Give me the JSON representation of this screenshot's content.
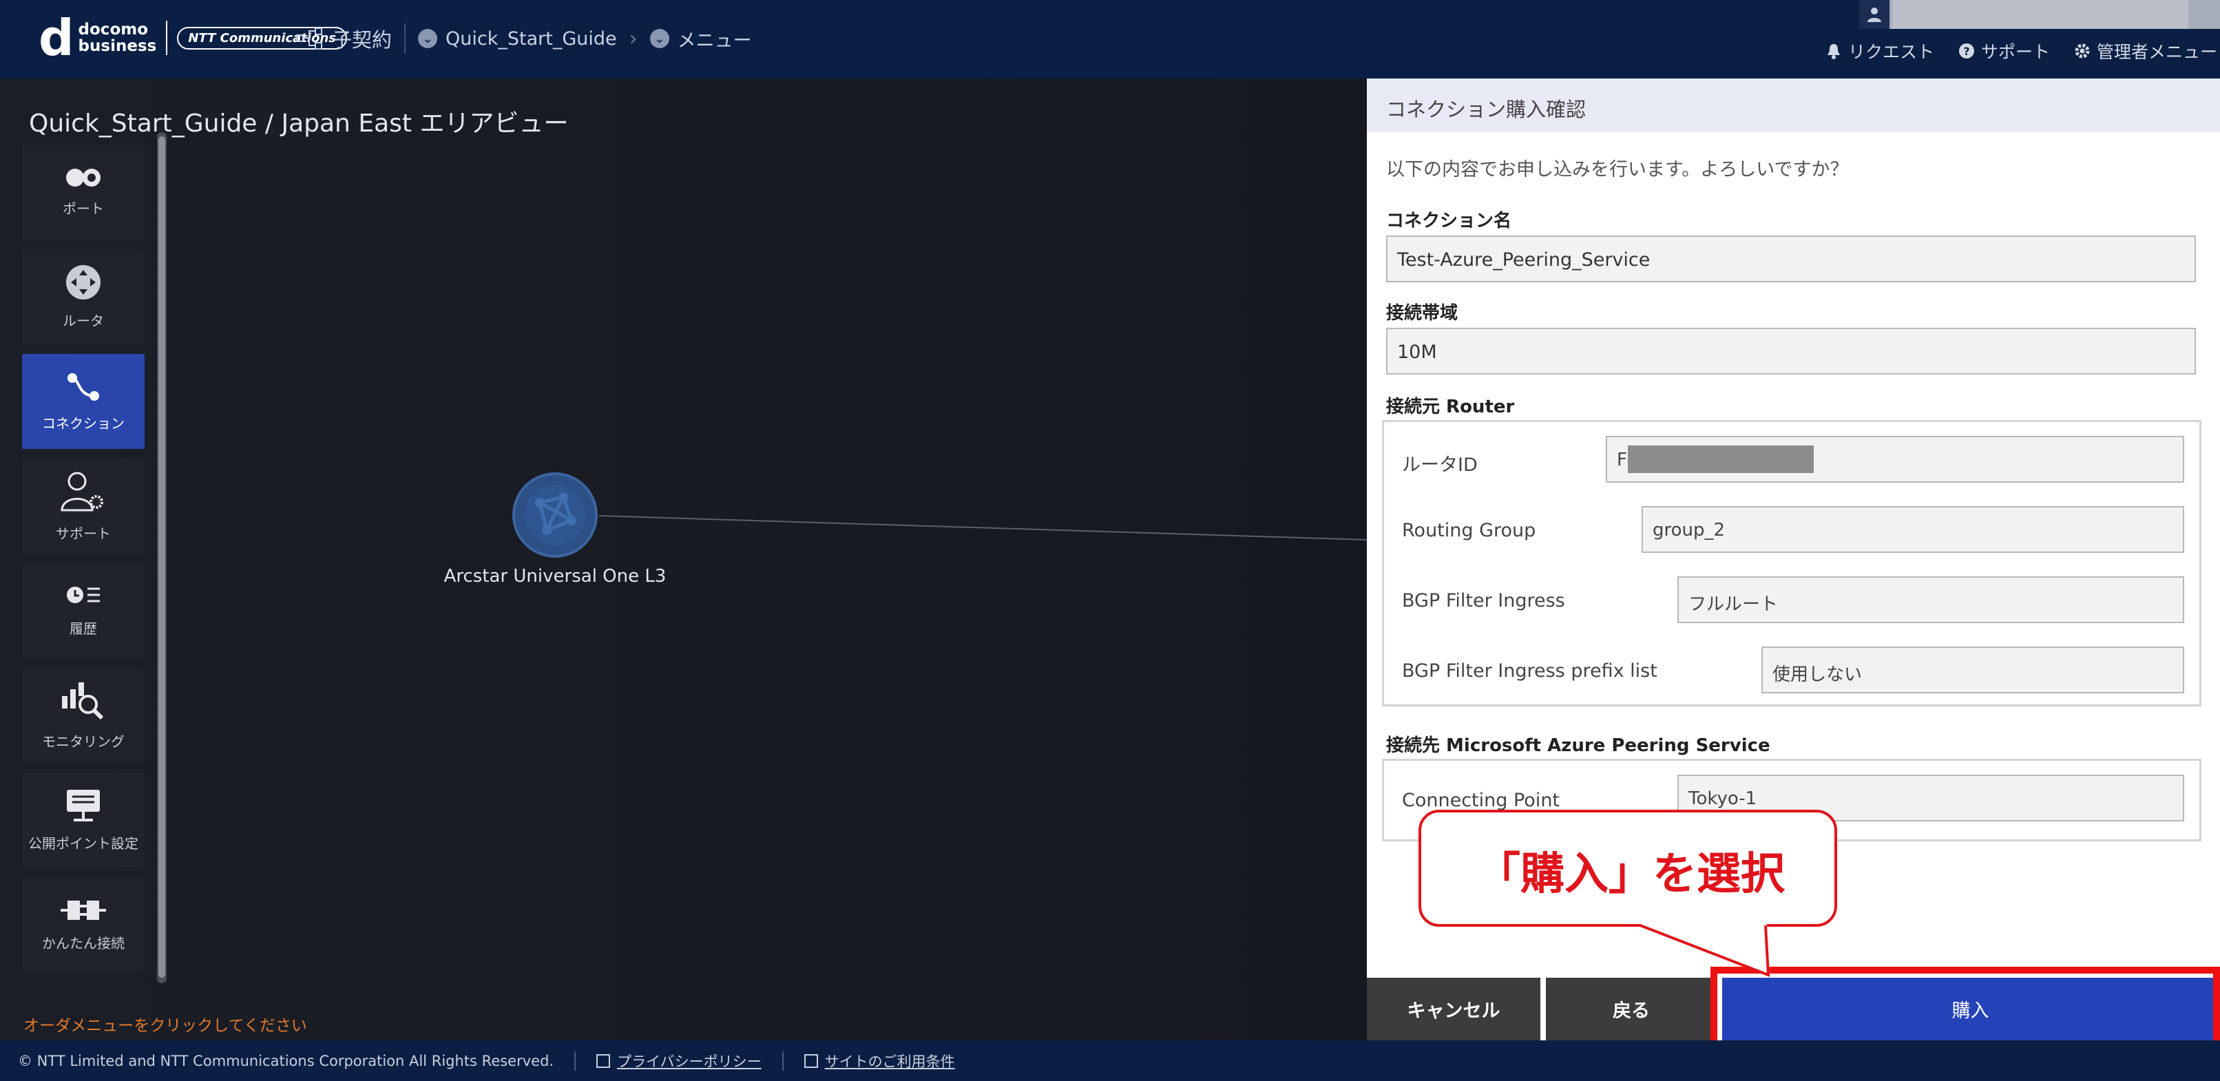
{
  "header": {
    "logo_line1": "docomo",
    "logo_line2": "business",
    "ntt_badge": "NTT Communications",
    "subcontract_label": "子契約",
    "breadcrumb_project": "Quick_Start_Guide",
    "breadcrumb_menu": "メニュー",
    "links": {
      "request": "リクエスト",
      "support": "サポート",
      "admin_menu": "管理者メニュー"
    }
  },
  "canvas": {
    "area_title": "Quick_Start_Guide / Japan East エリアビュー",
    "tools": [
      {
        "label": "ポート",
        "icon": "port-icon"
      },
      {
        "label": "ルータ",
        "icon": "router-icon"
      },
      {
        "label": "コネクション",
        "icon": "connection-icon",
        "active": true
      },
      {
        "label": "サポート",
        "icon": "support-person-icon"
      },
      {
        "label": "履歴",
        "icon": "history-icon"
      },
      {
        "label": "モニタリング",
        "icon": "monitoring-icon"
      },
      {
        "label": "公開ポイント設定",
        "icon": "public-point-icon"
      },
      {
        "label": "かんたん接続",
        "icon": "easy-connect-icon"
      }
    ],
    "order_hint": "オーダメニューをクリックしてください",
    "node_label": "Arcstar Universal One L3"
  },
  "panel": {
    "title": "コネクション購入確認",
    "intro": "以下の内容でお申し込みを行います。よろしいですか？",
    "connection_name_label": "コネクション名",
    "connection_name": "Test-Azure_Peering_Service",
    "bandwidth_label": "接続帯域",
    "bandwidth": "10M",
    "source_label": "接続元 Router",
    "router_id_label": "ルータID",
    "router_id_prefix": "F",
    "routing_group_label": "Routing Group",
    "routing_group": "group_2",
    "bgp_ingress_label": "BGP Filter Ingress",
    "bgp_ingress": "フルルート",
    "bgp_prefix_label": "BGP Filter Ingress prefix list",
    "bgp_prefix": "使用しない",
    "dest_label": "接続先 Microsoft Azure Peering Service",
    "connecting_point_label": "Connecting Point",
    "connecting_point": "Tokyo-1",
    "buttons": {
      "cancel": "キャンセル",
      "back": "戻る",
      "buy": "購入"
    }
  },
  "callout": {
    "text": "「購入」を選択"
  },
  "footer": {
    "copyright": "© NTT Limited and NTT Communications Corporation All Rights Reserved.",
    "privacy": "プライバシーポリシー",
    "terms": "サイトのご利用条件"
  },
  "colors": {
    "header_bg": "#0b1f44",
    "accent_blue": "#2543b8",
    "highlight_red": "#e0151b",
    "hint_orange": "#e07a2a"
  }
}
